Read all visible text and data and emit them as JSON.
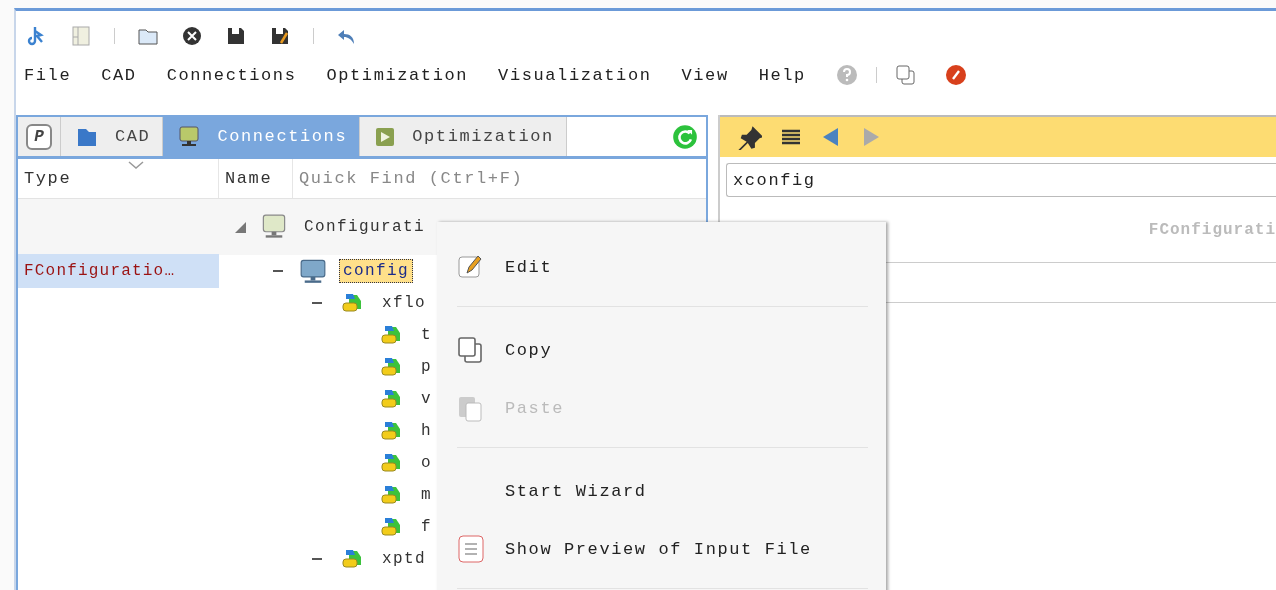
{
  "menu_bar": {
    "items": [
      "File",
      "CAD",
      "Connections",
      "Optimization",
      "Visualization",
      "View",
      "Help"
    ]
  },
  "left_panel": {
    "tabs": [
      {
        "kind": "badge",
        "label": "P",
        "selected": false
      },
      {
        "kind": "folder",
        "label": "CAD",
        "selected": false
      },
      {
        "kind": "monitor",
        "label": "Connections",
        "selected": true
      },
      {
        "kind": "play",
        "label": "Optimization",
        "selected": false
      }
    ],
    "columns": [
      "Type",
      "Name"
    ],
    "quick_find": {
      "placeholder": "Quick Find (Ctrl+F)"
    },
    "tree": [
      {
        "label": "Configurati",
        "kind": "monitor",
        "expanded": true,
        "selected": false,
        "children": [
          {
            "label": "config",
            "type": "FConfiguratio…",
            "kind": "shm",
            "expanded": true,
            "selected": true,
            "children": [
              {
                "label": "xflo",
                "kind": "layers",
                "expanded": true,
                "selected": false,
                "children": [
                  {
                    "label": "t",
                    "kind": "layers",
                    "selected": false
                  },
                  {
                    "label": "p",
                    "kind": "layers",
                    "selected": false
                  },
                  {
                    "label": "v",
                    "kind": "layers",
                    "selected": false
                  },
                  {
                    "label": "h",
                    "kind": "layers",
                    "selected": false
                  },
                  {
                    "label": "o",
                    "kind": "layers",
                    "selected": false
                  },
                  {
                    "label": "m",
                    "kind": "layers",
                    "selected": false
                  },
                  {
                    "label": "f",
                    "kind": "layers",
                    "selected": false
                  }
                ]
              },
              {
                "label": "xptd",
                "kind": "layers",
                "expanded": true,
                "selected": false
              }
            ]
          }
        ]
      }
    ]
  },
  "context_menu": {
    "items": [
      {
        "kind": "edit",
        "label": "Edit",
        "disabled": false
      },
      {
        "kind": "separator"
      },
      {
        "kind": "copy",
        "label": "Copy",
        "disabled": false
      },
      {
        "kind": "paste",
        "label": "Paste",
        "disabled": true
      },
      {
        "kind": "separator"
      },
      {
        "kind": "plain",
        "label": "Start Wizard",
        "disabled": false
      },
      {
        "kind": "preview",
        "label": "Show Preview of Input File",
        "disabled": false
      },
      {
        "kind": "separator"
      }
    ]
  },
  "right_panel": {
    "nav": [
      {
        "kind": "back",
        "disabled": false
      },
      {
        "kind": "forward",
        "disabled": true
      }
    ],
    "field": {
      "value": "xconfig"
    },
    "heading": "FConfigurati"
  }
}
